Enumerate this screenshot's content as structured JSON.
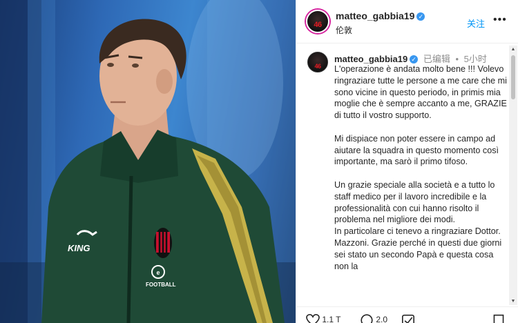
{
  "photo": {
    "alt_subject": "player-portrait",
    "jersey_sponsor": "KING",
    "jersey_emblem": "FOOTBALL",
    "colors": {
      "jacket": "#1f4a36",
      "stripe": "#c7b34a",
      "background": "#2e69b6"
    }
  },
  "header": {
    "username": "matteo_gabbia19",
    "location": "伦敦",
    "follow_label": "关注",
    "more_label": "•••",
    "avatar_number": "46"
  },
  "caption": {
    "username": "matteo_gabbia19",
    "edited_label": "已编辑",
    "separator": "•",
    "time": "5小时",
    "avatar_number": "46",
    "paragraphs": [
      "L'operazione è andata molto bene !!! Volevo ringraziare tutte le persone a me care che mi sono vicine in questo periodo, in primis mia moglie che è sempre accanto a me, GRAZIE di tutto il vostro supporto.",
      "Mi dispiace non poter essere in campo ad aiutare la squadra in questo momento così importante, ma sarò il primo tifoso.",
      "Un grazie speciale alla società e a tutto lo staff medico per il lavoro incredibile e la professionalità con cui hanno risolto il problema nel migliore dei modi.\nIn particolare ci tenevo a ringraziare Dottor. Mazzoni. Grazie perché in questi due giorni sei stato un secondo Papà e questa cosa non la"
    ]
  },
  "actions": {
    "likes_partial": "1.1 T",
    "comments_partial": "2.0"
  },
  "colors": {
    "accent": "#0095f6",
    "verified": "#3897f0",
    "muted": "#8e8e8e"
  }
}
